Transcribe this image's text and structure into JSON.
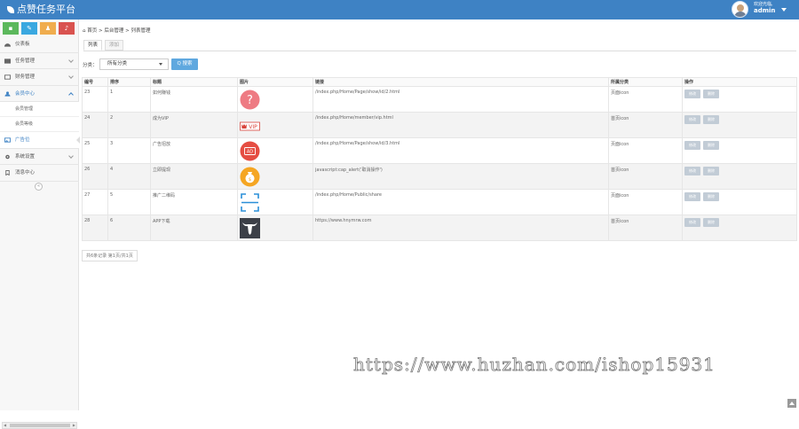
{
  "app": {
    "title": "点赞任务平台"
  },
  "user": {
    "greeting": "欢迎光临,",
    "name": "admin"
  },
  "shortcuts": [
    {
      "icon": "chart-icon",
      "color": "#5cb85c",
      "glyph": "▪"
    },
    {
      "icon": "pencil-icon",
      "color": "#3aa8e0",
      "glyph": "✎"
    },
    {
      "icon": "group-icon",
      "color": "#f0ad4e",
      "glyph": "♟"
    },
    {
      "icon": "bell-icon",
      "color": "#d9534f",
      "glyph": "♪"
    }
  ],
  "nav": {
    "items": [
      {
        "label": "仪表板",
        "icon": "dashboard-icon",
        "color": "#666"
      },
      {
        "label": "任务管理",
        "icon": "tasks-icon",
        "color": "#666"
      },
      {
        "label": "财务管理",
        "icon": "finance-icon",
        "color": "#666"
      },
      {
        "label": "会员中心",
        "icon": "user-icon",
        "color": "#3e82c4"
      },
      {
        "label": "会员管理"
      },
      {
        "label": "会员等级"
      },
      {
        "label": "广告位",
        "icon": "picture-icon",
        "color": "#3e82c4"
      },
      {
        "label": "系统设置",
        "icon": "settings-icon",
        "color": "#666"
      },
      {
        "label": "消息中心",
        "icon": "bookmark-icon",
        "color": "#666"
      }
    ],
    "collapse_glyph": "«"
  },
  "breadcrumb": {
    "home": "首页",
    "sep": ">",
    "level1": "后台管理",
    "level2": "列表管理"
  },
  "tabs": [
    {
      "label": "列表"
    },
    {
      "label": "添加"
    }
  ],
  "filter": {
    "label": "分类：",
    "selected": "所有分类",
    "search_label": "Q 搜索"
  },
  "table": {
    "headers": [
      "编号",
      "排序",
      "标题",
      "图片",
      "链接",
      "所属分类",
      "操作"
    ],
    "rows": [
      {
        "id": "23",
        "sort": "1",
        "title": "如何赚钱",
        "image": "question",
        "link": "/index.php/Home/Page/show/id/2.html",
        "category": "页面icon",
        "ops": [
          "修改",
          "删除"
        ]
      },
      {
        "id": "24",
        "sort": "2",
        "title": "成为VIP",
        "image": "vip",
        "link": "/index.php/Home/member/vip.html",
        "category": "首页icon",
        "ops": [
          "修改",
          "删除"
        ]
      },
      {
        "id": "25",
        "sort": "3",
        "title": "广告招放",
        "image": "ad",
        "link": "/index.php/Home/Page/show/id/3.html",
        "category": "页面icon",
        "ops": [
          "修改",
          "删除"
        ]
      },
      {
        "id": "26",
        "sort": "4",
        "title": "立即提现",
        "image": "money",
        "link": "javascript:cap_alert('取消操作')",
        "category": "首页icon",
        "ops": [
          "修改",
          "删除"
        ]
      },
      {
        "id": "27",
        "sort": "5",
        "title": "推广二维码",
        "image": "scan",
        "link": "/index.php/Home/Public/share",
        "category": "页面icon",
        "ops": [
          "修改",
          "删除"
        ]
      },
      {
        "id": "28",
        "sort": "6",
        "title": "APP下载",
        "image": "bull",
        "link": "https://www.hnymrw.com",
        "category": "首页icon",
        "ops": [
          "修改",
          "删除"
        ]
      }
    ]
  },
  "pager": {
    "text": "共6条记录 第1页/共1页"
  },
  "watermark": {
    "text": "https://www.huzhan.com/ishop15931"
  },
  "colors": {
    "header": "#3e82c4",
    "accent": "#3e82c4",
    "search_button": "#5fa8df"
  }
}
